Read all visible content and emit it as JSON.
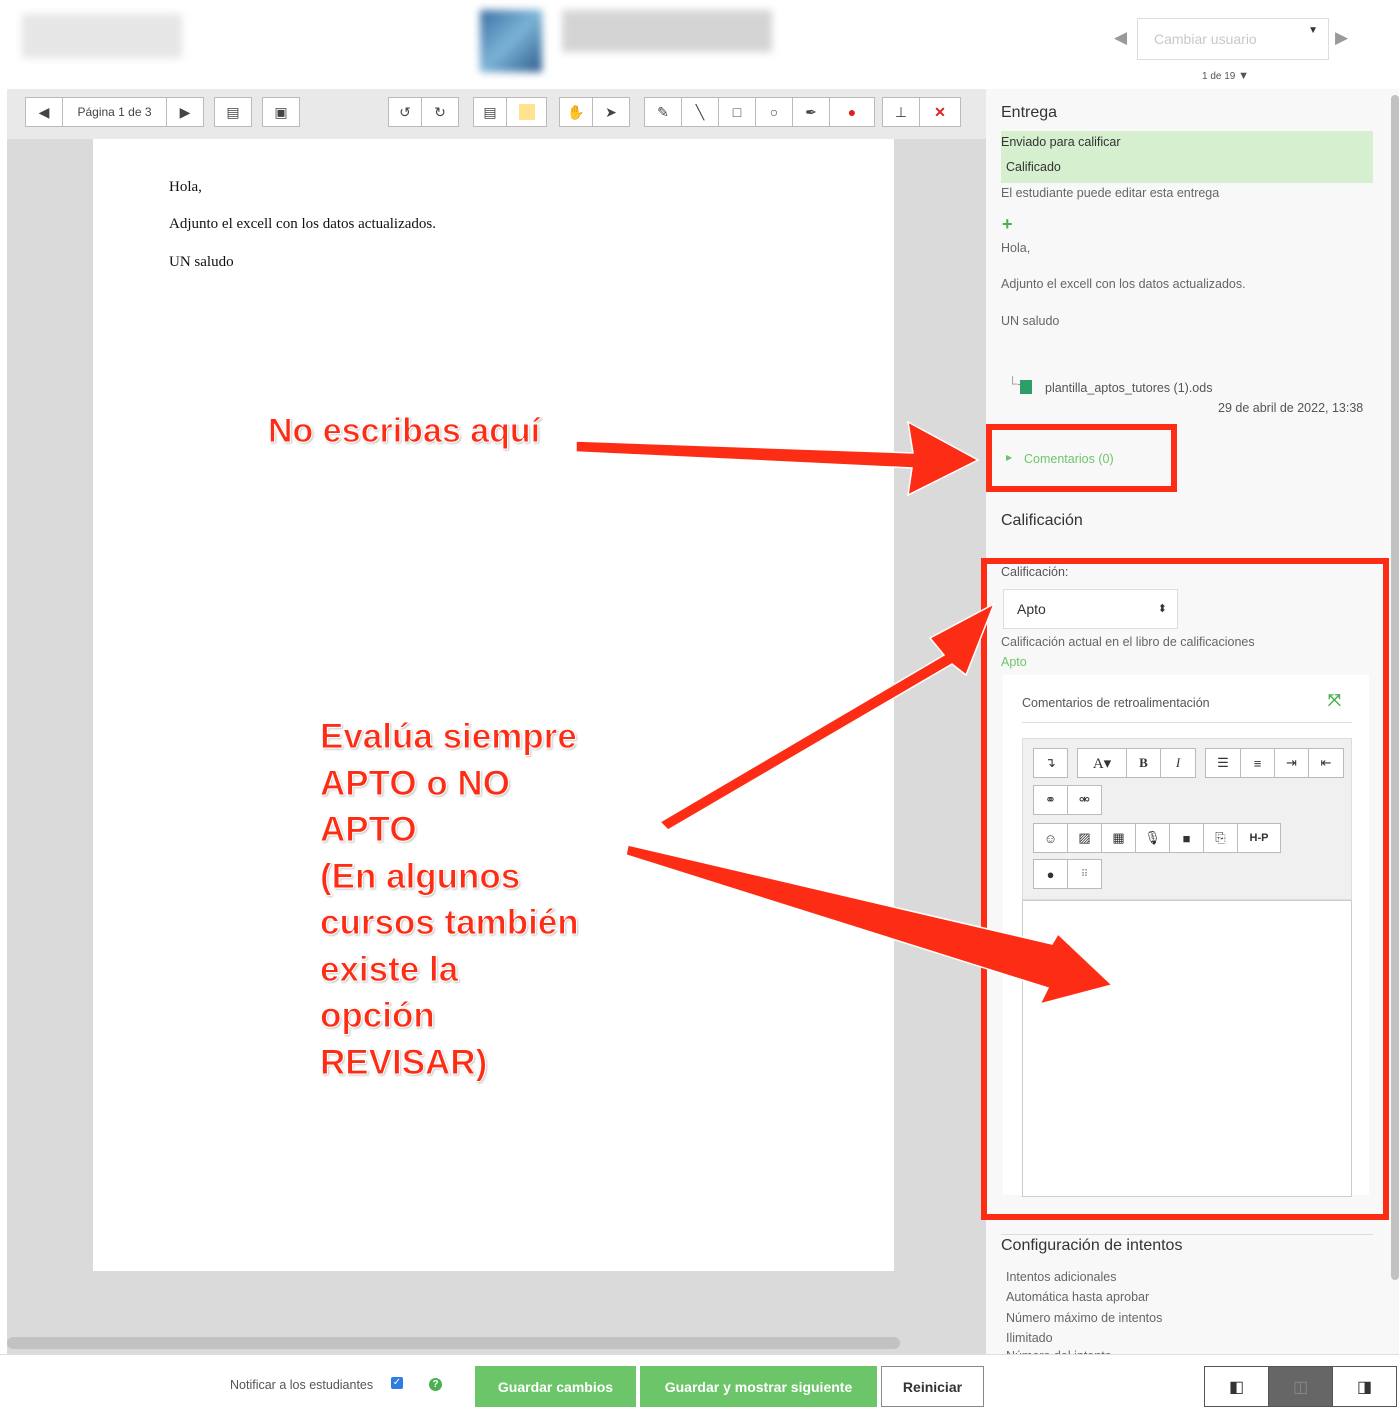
{
  "header": {
    "user_select_placeholder": "Cambiar usuario",
    "user_count": "1 de 19"
  },
  "viewer": {
    "page_label": "Página 1 de 3",
    "document_lines": [
      "Hola,",
      "Adjunto el excell con los datos actualizados.",
      "UN saludo"
    ]
  },
  "submission": {
    "title": "Entrega",
    "status_sent": "Enviado para calificar",
    "status_graded": "Calificado",
    "edit_note": "El estudiante puede editar esta entrega",
    "text_lines": [
      "Hola,",
      "Adjunto el excell con los datos actualizados.",
      "UN saludo"
    ],
    "file_name": "plantilla_aptos_tutores (1).ods",
    "file_date": "29 de abril de 2022, 13:38",
    "comments_link": "Comentarios (0)"
  },
  "grading": {
    "title": "Calificación",
    "field_label": "Calificación:",
    "selected_grade": "Apto",
    "gradebook_label": "Calificación actual en el libro de calificaciones",
    "gradebook_value": "Apto",
    "feedback_title": "Comentarios de retroalimentación"
  },
  "attempts": {
    "title": "Configuración de intentos",
    "items": [
      "Intentos adicionales",
      "Automática hasta aprobar",
      "Número máximo de intentos",
      "Ilimitado",
      "Número del intento"
    ]
  },
  "footer": {
    "notify_label": "Notificar a los estudiantes",
    "save_label": "Guardar cambios",
    "save_next_label": "Guardar y mostrar siguiente",
    "reset_label": "Reiniciar"
  },
  "annotations": {
    "no_write": "No escribas aquí",
    "evaluate_lines": [
      "Evalúa siempre",
      "APTO o NO",
      "APTO",
      "(En algunos",
      "cursos también",
      "existe la",
      "opción",
      "REVISAR)"
    ]
  },
  "colors": {
    "accent_green": "#6dc56a",
    "annotation_red": "#fc2d14",
    "status_bg": "#d6efce"
  }
}
